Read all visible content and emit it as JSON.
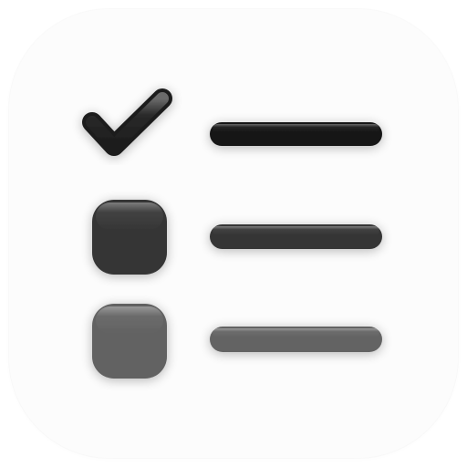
{
  "icon": {
    "name": "checklist-app-icon",
    "background_color": "#fcfcfc",
    "items": [
      {
        "marker": "checkmark-icon",
        "marker_color": "#1c1c1c",
        "line_color": "#151515",
        "state": "checked"
      },
      {
        "marker": "filled-square-icon",
        "marker_color": "#363636",
        "line_color": "#353535",
        "state": "unchecked"
      },
      {
        "marker": "filled-square-icon",
        "marker_color": "#626262",
        "line_color": "#636363",
        "state": "unchecked"
      }
    ]
  }
}
